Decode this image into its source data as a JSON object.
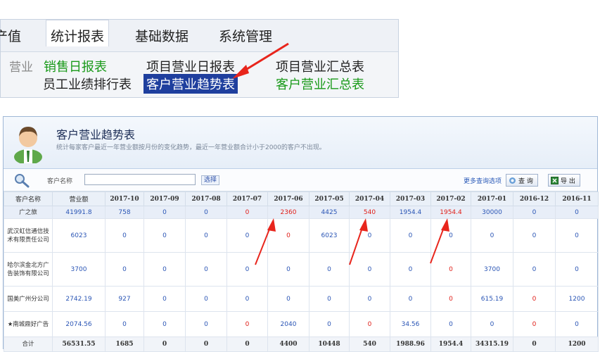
{
  "menu": {
    "tabs": [
      {
        "label": "产值"
      },
      {
        "label": "统计报表"
      },
      {
        "label": "基础数据"
      },
      {
        "label": "系统管理"
      }
    ],
    "submenu_prefix": "营业",
    "submenu": [
      {
        "label": "销售日报表"
      },
      {
        "label": "项目营业日报表"
      },
      {
        "label": "项目营业汇总表"
      },
      {
        "label": "员工业绩排行表"
      },
      {
        "label": "客户营业趋势表"
      },
      {
        "label": "客户营业汇总表"
      }
    ]
  },
  "report": {
    "title": "客户营业趋势表",
    "description": "统计每家客户最近一年营业额按月份的变化趋势，最近一年营业额合计小于2000的客户不出现。"
  },
  "search": {
    "label": "客户名称",
    "value": "",
    "select_button": "选择",
    "more_options": "更多查询选项",
    "query_button": "查 询",
    "export_button": "导 出"
  },
  "table": {
    "columns": [
      "客户名称",
      "营业额",
      "2017-10",
      "2017-09",
      "2017-08",
      "2017-07",
      "2017-06",
      "2017-05",
      "2017-04",
      "2017-03",
      "2017-02",
      "2017-01",
      "2016-12",
      "2016-11"
    ],
    "rows": [
      {
        "name": "广之旅",
        "cells": [
          "41991.8",
          "758",
          "0",
          "0",
          "0",
          "2360",
          "4425",
          "540",
          "1954.4",
          "1954.4",
          "30000",
          "0",
          "0"
        ]
      },
      {
        "name": "武汉虹信通信技术有限责任公司",
        "cells": [
          "6023",
          "0",
          "0",
          "0",
          "0",
          "0",
          "6023",
          "0",
          "0",
          "0",
          "0",
          "0",
          "0"
        ]
      },
      {
        "name": "哈尔滨金北方广告装饰有限公司",
        "cells": [
          "3700",
          "0",
          "0",
          "0",
          "0",
          "0",
          "0",
          "0",
          "0",
          "0",
          "3700",
          "0",
          "0"
        ]
      },
      {
        "name": "国美广州分公司",
        "cells": [
          "2742.19",
          "927",
          "0",
          "0",
          "0",
          "0",
          "0",
          "0",
          "0",
          "0",
          "615.19",
          "0",
          "1200"
        ]
      },
      {
        "name": "★南城鼎好广告",
        "cells": [
          "2074.56",
          "0",
          "0",
          "0",
          "0",
          "2040",
          "0",
          "0",
          "34.56",
          "0",
          "0",
          "0",
          "0"
        ]
      }
    ],
    "total": {
      "name": "合计",
      "cells": [
        "56531.55",
        "1685",
        "0",
        "0",
        "0",
        "4400",
        "10448",
        "540",
        "1988.96",
        "1954.4",
        "34315.19",
        "0",
        "1200"
      ]
    }
  },
  "colors": {
    "link_blue": "#2a55b5",
    "alert_red": "#e0201a",
    "annotation_red": "#e8251c",
    "selected_menu": "#1f3f9e",
    "green_link": "#1a9a1a"
  }
}
